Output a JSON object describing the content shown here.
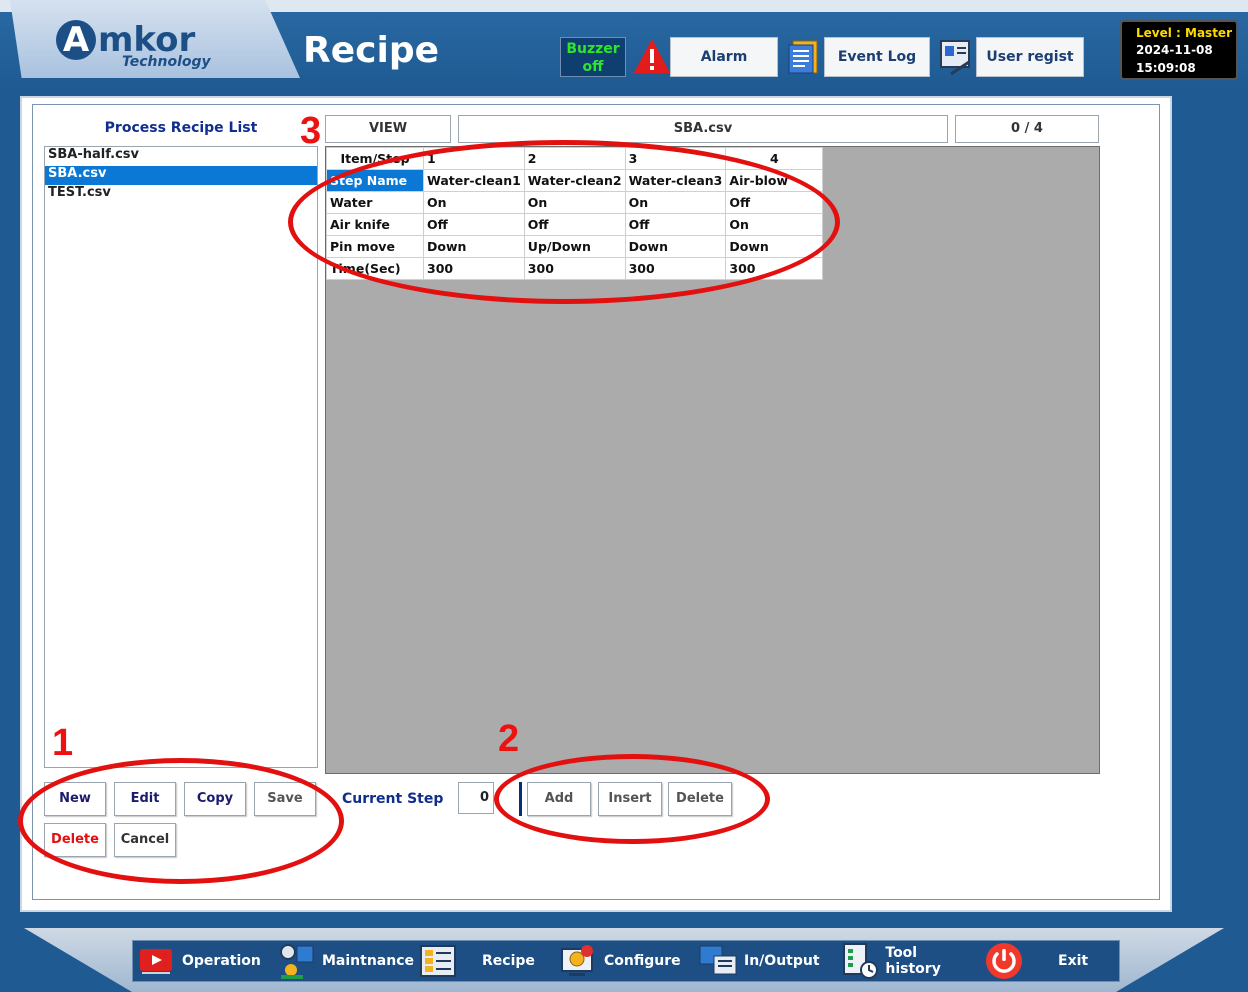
{
  "header": {
    "logo_letter": "A",
    "logo_word": "mkor",
    "logo_sub": "Technology",
    "title": "Recipe",
    "buzzer_line1": "Buzzer",
    "buzzer_line2": "off",
    "alarm_label": "Alarm",
    "event_log_label": "Event Log",
    "user_regist_label": "User regist",
    "level": "Level : Master",
    "date": "2024-11-08",
    "time": "15:09:08"
  },
  "recipe_list": {
    "title": "Process Recipe List",
    "items": [
      "SBA-half.csv",
      "SBA.csv",
      "TEST.csv"
    ],
    "selected_index": 1
  },
  "recipe_buttons": {
    "new": "New",
    "edit": "Edit",
    "copy": "Copy",
    "save": "Save",
    "delete": "Delete",
    "cancel": "Cancel"
  },
  "view": {
    "mode": "VIEW",
    "file": "SBA.csv",
    "counter": "0 / 4"
  },
  "step_table": {
    "header": [
      "Item/Step",
      "1",
      "2",
      "3",
      "4"
    ],
    "rows": [
      [
        "Step Name",
        "Water-clean1",
        "Water-clean2",
        "Water-clean3",
        "Air-blow"
      ],
      [
        "Water",
        "On",
        "On",
        "On",
        "Off"
      ],
      [
        "Air knife",
        "Off",
        "Off",
        "Off",
        "On"
      ],
      [
        "Pin move",
        "Down",
        "Up/Down",
        "Down",
        "Down"
      ],
      [
        "Time(Sec)",
        "300",
        "300",
        "300",
        "300"
      ]
    ]
  },
  "step_controls": {
    "current_step_label": "Current Step",
    "current_step_value": "0",
    "add": "Add",
    "insert": "Insert",
    "delete": "Delete"
  },
  "annotations": [
    "1",
    "2",
    "3"
  ],
  "footer_nav": {
    "operation": "Operation",
    "maintnance": "Maintnance",
    "recipe": "Recipe",
    "configure": "Configure",
    "in_output": "In/Output",
    "tool_history": "Tool history",
    "exit": "Exit"
  },
  "colors": {
    "accent_blue": "#0a78d4",
    "title_navy": "#102e8e",
    "annotation_red": "#e31010",
    "buzzer_green": "#2ee62e",
    "level_yellow": "#ffd800"
  }
}
